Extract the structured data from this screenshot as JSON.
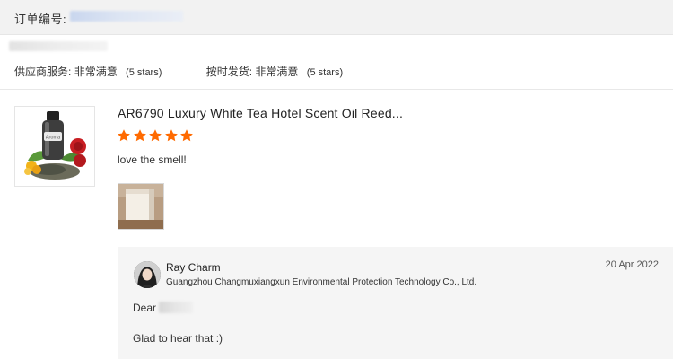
{
  "order": {
    "label": "订单编号:"
  },
  "ratings": [
    {
      "label": "供应商服务:",
      "value": "非常满意",
      "count": "(5 stars)"
    },
    {
      "label": "按时发货:",
      "value": "非常满意",
      "count": "(5 stars)"
    }
  ],
  "product": {
    "title": "AR6790 Luxury White Tea Hotel Scent Oil Reed...",
    "image_label": "Aroma",
    "rating": 5,
    "max_rating": 5,
    "star_color": "#ff6a00",
    "review": "love the smell!"
  },
  "reply": {
    "name": "Ray Charm",
    "company": "Guangzhou Changmuxiangxun Environmental Protection Technology Co., Ltd.",
    "date": "20 Apr 2022",
    "greeting": "Dear",
    "message": "Glad to hear that :)"
  },
  "colors": {
    "header_bg": "#f2f2f2",
    "reply_bg": "#f5f5f5",
    "accent": "#ff6a00"
  }
}
